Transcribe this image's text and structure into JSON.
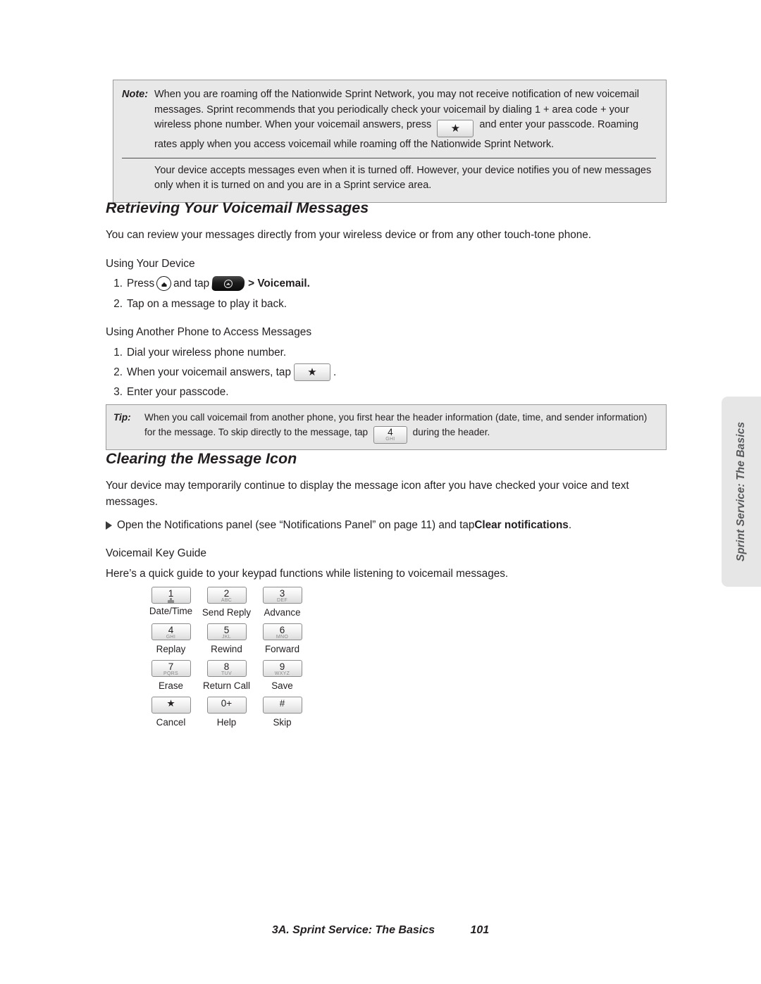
{
  "side_tab": {
    "label": "Sprint Service: The Basics"
  },
  "note_box": {
    "tag": "Note:",
    "paragraph1_a": "When you are roaming off the Nationwide Sprint Network, you may not receive notification of new voicemail messages. Sprint recommends that you periodically check your voicemail by dialing 1 + area code + your wireless phone number. When your voicemail answers, press",
    "key_label": "★",
    "paragraph1_b": "and enter your passcode. Roaming rates apply when you access voicemail while roaming off the Nationwide Sprint Network.",
    "paragraph2": "Your device accepts messages even when it is turned off. However, your device notifies you of new messages only when it is turned on and you are in a Sprint service area."
  },
  "section1": {
    "heading": "Retrieving Your Voicemail Messages",
    "intro": "You can review your messages directly from your wireless device or from any other touch-tone phone.",
    "sub_head": "Using Your Device",
    "step1_pre": "Press",
    "step1_mid": "and tap",
    "step1_post": "> Voicemail.",
    "step1_num": "1.",
    "step2_num": "2.",
    "step2_text": "Tap on a message to play it back."
  },
  "section2": {
    "sub_head": "Using Another Phone to Access Messages",
    "step1_num": "1.",
    "step1_text": "Dial your wireless phone number.",
    "step2_num": "2.",
    "step2_text": "When your voicemail answers, tap",
    "step2_key": "★",
    "step2_after": ".",
    "step3_num": "3.",
    "step3_text": "Enter your passcode."
  },
  "tip_box": {
    "tag": "Tip:",
    "text_a": "When you call voicemail from another phone, you first hear the header information (date, time, and sender information) for the message. To skip directly to the message, tap",
    "key_digit": "4",
    "key_letters": "GHI",
    "text_b": "during the header."
  },
  "section3": {
    "heading": "Clearing the Message Icon",
    "body": "Your device may temporarily continue to display the message icon after you have checked your voice and text messages.",
    "bullet_pre": "Open the Notifications panel (see “Notifications Panel” on page 11) and tap ",
    "bullet_bold": "Clear notifications",
    "bullet_post": ".",
    "sub_head": "Voicemail Key Guide",
    "intro": "Here’s a quick guide to your keypad functions while listening to voicemail messages."
  },
  "key_guide": {
    "rows": [
      [
        {
          "digit": "1",
          "letters": "",
          "glyph": "voicemail-glyph",
          "caption": "Date/Time"
        },
        {
          "digit": "2",
          "letters": "ABC",
          "glyph": "",
          "caption": "Send Reply"
        },
        {
          "digit": "3",
          "letters": "DEF",
          "glyph": "",
          "caption": "Advance"
        }
      ],
      [
        {
          "digit": "4",
          "letters": "GHI",
          "glyph": "",
          "caption": "Replay"
        },
        {
          "digit": "5",
          "letters": "JKL",
          "glyph": "",
          "caption": "Rewind"
        },
        {
          "digit": "6",
          "letters": "MNO",
          "glyph": "",
          "caption": "Forward"
        }
      ],
      [
        {
          "digit": "7",
          "letters": "PQRS",
          "glyph": "",
          "caption": "Erase"
        },
        {
          "digit": "8",
          "letters": "TUV",
          "glyph": "",
          "caption": "Return Call"
        },
        {
          "digit": "9",
          "letters": "WXYZ",
          "glyph": "",
          "caption": "Save"
        }
      ],
      [
        {
          "digit": "★",
          "letters": "",
          "glyph": "",
          "caption": "Cancel"
        },
        {
          "digit": "0+",
          "letters": "",
          "glyph": "",
          "caption": "Help"
        },
        {
          "digit": "#",
          "letters": "",
          "glyph": "",
          "caption": "Skip"
        }
      ]
    ]
  },
  "footer": {
    "title": "3A. Sprint Service: The Basics",
    "page": "101"
  },
  "colors": {
    "text": "#231f20",
    "callout_bg": "#e8e8e8",
    "callout_border": "#9a9a9a",
    "side_tab_bg": "#e6e6e6",
    "side_tab_text": "#58595b"
  }
}
